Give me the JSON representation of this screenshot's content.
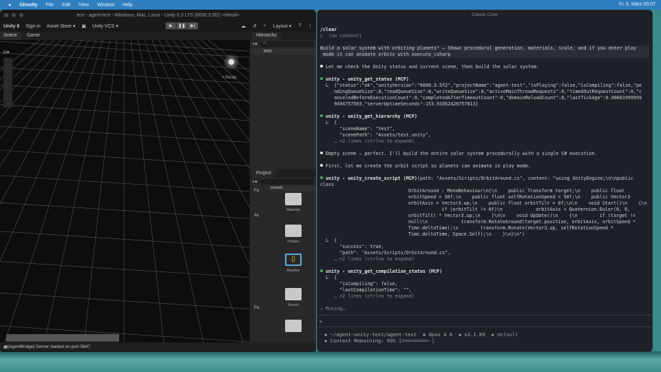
{
  "menubar": {
    "app": "Ghostty",
    "items": [
      "File",
      "Edit",
      "View",
      "Window",
      "Help"
    ],
    "clock": "Fr. 6. März  00:07"
  },
  "unity": {
    "title": "test - agent-test - Windows, Mac, Linux - Unity 6.3 LTS (6000.3.5f2) <Metal>",
    "brand": "Unity 6",
    "sign_in": "Sign in",
    "asset_store": "Asset Store ▾",
    "vcs": "Unity VCS ▾",
    "layout": "Layout ▾",
    "tabs": [
      "Scene",
      "Game"
    ],
    "persp": "< Persp",
    "hierarchy": {
      "title": "Hierarchy",
      "search": "All",
      "items": [
        "test"
      ]
    },
    "project": {
      "title": "Project",
      "tree_favorites": "Fa",
      "tree_assets": "As",
      "tree_packages": "Pa",
      "breadcrumb": "Assets",
      "assets": [
        "Materials",
        "Prefabs",
        "Readme",
        "Scenes"
      ]
    },
    "status": "[AgentBridge] Server started on port 5847"
  },
  "terminal": {
    "title": "Claude Code",
    "clear": "/clear",
    "no_content": "L  (no content)",
    "prompt_lines": [
      "Build a solar system with orbiting planets\" — Shows procedural generation, materials, scale, and if you enter play",
      " mode it can animate orbits with execute_csharp"
    ],
    "msg1": "Let me check the Unity status and current scene, then build the solar system.",
    "tool1": "unity - unity_get_status (MCP)",
    "tool1_out": [
      "L  {\"status\":\"ok\",\"unityVersion\":\"6000.3.5f2\",\"projectName\":\"agent-test\",\"isPlaying\":false,\"isCompiling\":false,\"pe",
      "   ndingQueueSize\":0,\"readQueueSize\":0,\"writeQueueSize\":0,\"activeMainThreadRequests\":0,\"timedOutRequestCount\":0,\"c",
      "   anceledBeforeExecutionCount\":0,\"completedAfterTimeoutCount\":0,\"domainReloadCount\":8,\"lastTickAge\":0.00001999999",
      "   9494757503,\"serverUptimeSeconds\":153.93362426757813}"
    ],
    "tool2": "unity - unity_get_hierarchy (MCP)",
    "tool2_out": [
      "L  {",
      "     \"sceneName\": \"test\",",
      "     \"scenePath\": \"Assets/test.unity\",",
      "   … +2 lines (ctrl+o to expand)"
    ],
    "msg2": "Empty scene — perfect. I'll build the entire solar system procedurally with a single C# execution.",
    "msg3": "First, let me create the orbit script so planets can animate in play mode.",
    "tool3": "unity - unity_create_script (MCP)",
    "tool3_args": [
      "(path: \"Assets/Scripts/OrbitAround.cs\", content: \"using UnityEngine;\\n\\npublic class",
      "OrbitAround : MonoBehaviour\\n{\\n    public Transform target;\\n    public float",
      "orbitSpeed = 30f;\\n    public float selfRotationSpeed = 50f;\\n    public Vector3",
      "orbitAxis = Vector3.up;\\n    public float orbitTilt = 0f;\\n\\n    void Start()\\n    {\\n",
      "            if (orbitTilt != 0f)\\n            orbitAxis = Quaternion.Euler(0, 0,",
      "orbitTilt) * Vector3.up;\\n    }\\n\\n    void Update()\\n    {\\n        if (target !=",
      "null)\\n            transform.RotateAround(target.position, orbitAxis, orbitSpeed *",
      "Time.deltaTime);\\n        transform.Rotate(Vector3.up, selfRotationSpeed *",
      "Time.deltaTime, Space.Self);\\n    }\\n}\\n\")"
    ],
    "tool3_out": [
      "L  {",
      "     \"success\": true,",
      "     \"path\": \"Assets/Scripts/OrbitAround.cs\",",
      "   … +2 lines (ctrl+o to expand)"
    ],
    "tool4": "unity - unity_get_compilation_status (MCP)",
    "tool4_out": [
      "L  {",
      "     \"isCompiling\": false,",
      "     \"lastCompilationTime\": \"\",",
      "   … +2 lines (ctrl+o to expand)"
    ],
    "musing": "✳ Musing…",
    "input_prompt": ">",
    "footer": {
      "path": "~/agent-unity-test/agent-test",
      "model": "Opus 4.6",
      "version": "v2.1.69",
      "mode": "default",
      "context": "Context Remaining: 93% [=========-]"
    }
  }
}
